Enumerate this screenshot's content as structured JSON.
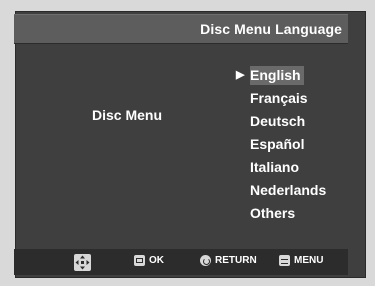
{
  "header": {
    "title": "Disc Menu Language"
  },
  "setting": {
    "label": "Disc Menu"
  },
  "languages": {
    "items": [
      {
        "label": "English",
        "selected": true
      },
      {
        "label": "Français",
        "selected": false
      },
      {
        "label": "Deutsch",
        "selected": false
      },
      {
        "label": "Español",
        "selected": false
      },
      {
        "label": "Italiano",
        "selected": false
      },
      {
        "label": "Nederlands",
        "selected": false
      },
      {
        "label": "Others",
        "selected": false
      }
    ],
    "cursor": "▶"
  },
  "footer": {
    "ok_label": "OK",
    "return_label": "RETURN",
    "menu_label": "MENU",
    "nav_icon": "direction-pad-icon"
  },
  "colors": {
    "background": "#3f3f3f",
    "title_bar": "#5d5d5d",
    "selection": "#6a6a6a",
    "footer": "#2c2c2c",
    "text": "#ffffff"
  }
}
